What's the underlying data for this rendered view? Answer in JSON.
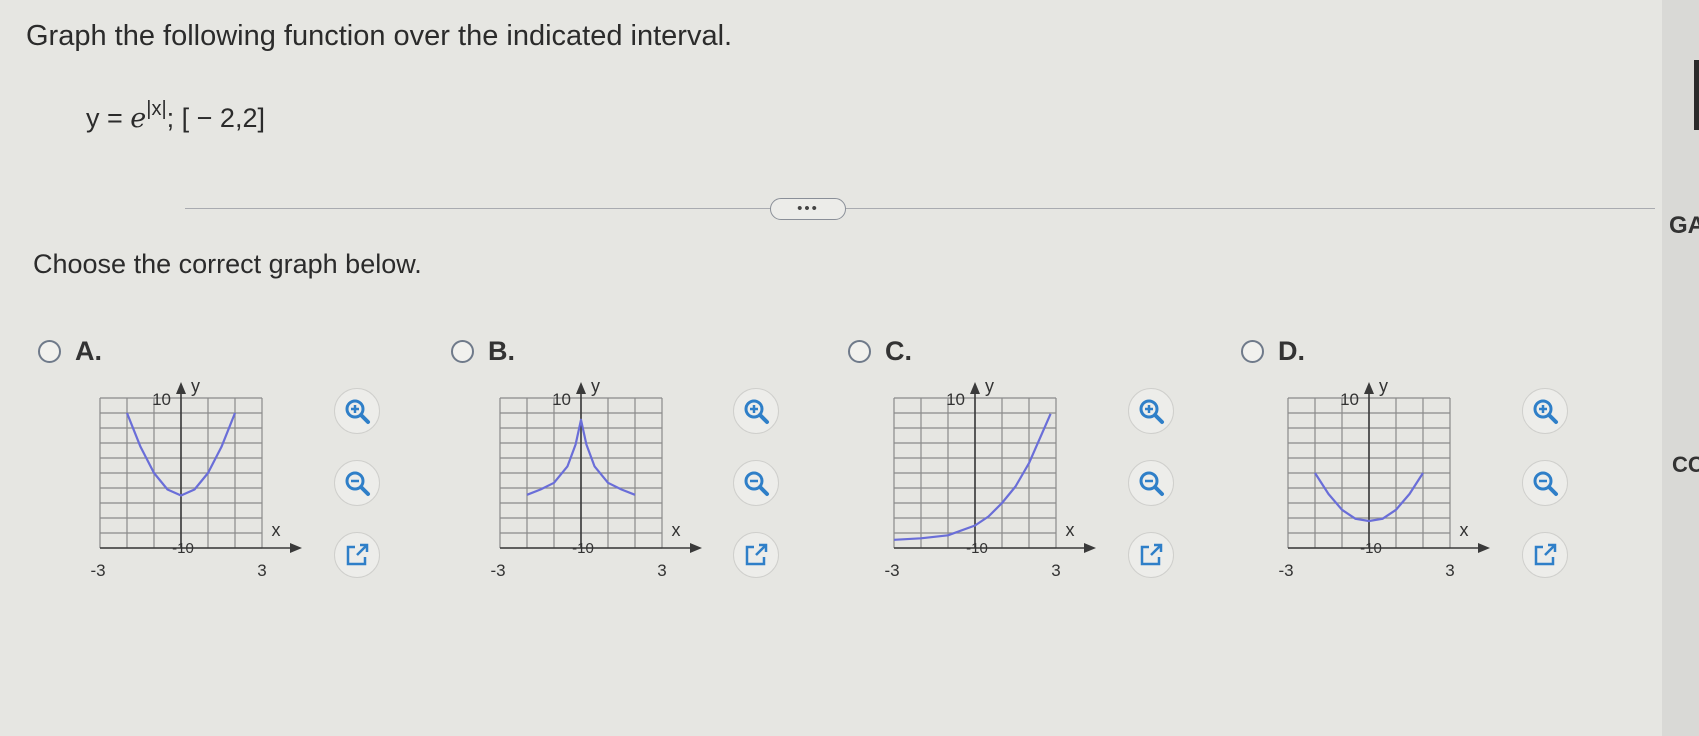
{
  "question": {
    "title": "Graph the following function over the indicated interval.",
    "function_lhs": "y = ",
    "function_base": "e",
    "function_exponent": "|x|",
    "function_interval": "; [ − 2,2]"
  },
  "more_button": "•••",
  "prompt": "Choose the correct graph below.",
  "options": [
    {
      "label": "A."
    },
    {
      "label": "B."
    },
    {
      "label": "C."
    },
    {
      "label": "D."
    }
  ],
  "axis_labels": {
    "y": "y",
    "x": "x",
    "y_top": "10",
    "y_bottom": "-10",
    "x_left": "-3",
    "x_right": "3"
  },
  "side_panel": {
    "text_top": "GA",
    "text_mid": "CC"
  },
  "colors": {
    "curve": "#6a6ed8",
    "grid": "#8a8a8a",
    "axis": "#3a3a3a",
    "tool_icon": "#2f7fc8"
  },
  "chart_data": [
    {
      "option": "A",
      "type": "line",
      "xlim": [
        -3,
        3
      ],
      "ylim": [
        -10,
        10
      ],
      "series": [
        {
          "x": [
            -2,
            -1.5,
            -1,
            -0.5,
            0,
            0.5,
            1,
            1.5,
            2
          ],
          "y": [
            8,
            3.5,
            0,
            -2.2,
            -3,
            -2.2,
            0,
            3.5,
            8
          ]
        }
      ]
    },
    {
      "option": "B",
      "type": "line",
      "xlim": [
        -3,
        3
      ],
      "ylim": [
        -10,
        10
      ],
      "series": [
        {
          "x": [
            -2,
            -1.5,
            -1,
            -0.5,
            -0.2,
            0,
            0.2,
            0.5,
            1,
            1.5,
            2
          ],
          "y": [
            -2.9,
            -2.2,
            -1.3,
            0.9,
            3.8,
            7.1,
            3.8,
            0.9,
            -1.3,
            -2.2,
            -2.9
          ]
        }
      ]
    },
    {
      "option": "C",
      "type": "line",
      "xlim": [
        -3,
        3
      ],
      "ylim": [
        -10,
        10
      ],
      "series": [
        {
          "x": [
            -3,
            -2,
            -1,
            0,
            0.5,
            1,
            1.5,
            2,
            2.8
          ],
          "y": [
            -8.9,
            -8.7,
            -8.3,
            -7,
            -5.8,
            -4,
            -1.8,
            1.3,
            7.9
          ]
        }
      ]
    },
    {
      "option": "D",
      "type": "line",
      "xlim": [
        -3,
        3
      ],
      "ylim": [
        -10,
        10
      ],
      "series": [
        {
          "x": [
            -2,
            -1.5,
            -1,
            -0.5,
            0,
            0.5,
            1,
            1.5,
            2
          ],
          "y": [
            0,
            -2.8,
            -4.9,
            -6.1,
            -6.4,
            -6.1,
            -4.9,
            -2.8,
            0
          ]
        }
      ]
    }
  ]
}
